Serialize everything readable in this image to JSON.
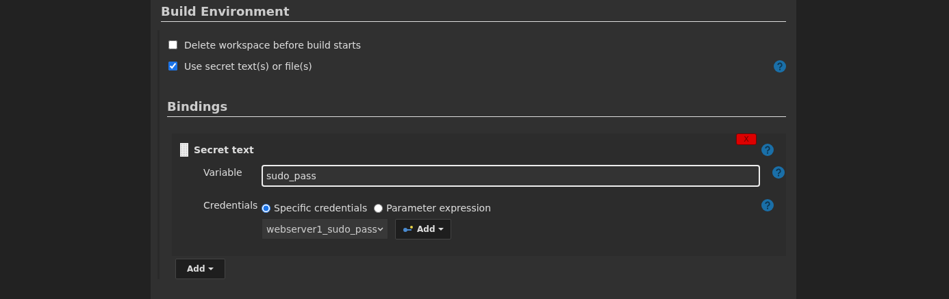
{
  "section_title": "Build Environment",
  "options": [
    {
      "label": "Delete workspace before build starts",
      "checked": false,
      "help": false
    },
    {
      "label": "Use secret text(s) or file(s)",
      "checked": true,
      "help": true
    }
  ],
  "bindings": {
    "title": "Bindings",
    "binding": {
      "title": "Secret text",
      "delete_label": "X",
      "variable": {
        "label": "Variable",
        "value": "sudo_pass"
      },
      "credentials": {
        "label": "Credentials",
        "modes": [
          {
            "label": "Specific credentials",
            "selected": true
          },
          {
            "label": "Parameter expression",
            "selected": false
          }
        ],
        "select_value": "webserver1_sudo_pass",
        "add_label": "Add"
      }
    },
    "add_label": "Add"
  }
}
